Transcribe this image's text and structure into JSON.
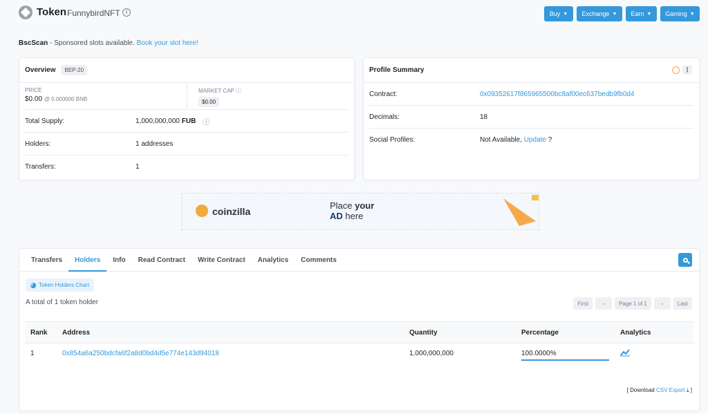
{
  "header": {
    "title": "Token",
    "token_name": "FunnybirdNFT",
    "buttons": [
      "Buy",
      "Exchange",
      "Earn",
      "Gaming"
    ]
  },
  "sponsor": {
    "brand": "BscScan",
    "text": " - Sponsored slots available. ",
    "link": "Book your slot here!"
  },
  "overview": {
    "title": "Overview",
    "badge": "BEP-20",
    "price_label": "PRICE",
    "price_value": "$0.00",
    "price_bnb": "@ 0.000000 BNB",
    "mcap_label": "MARKET CAP",
    "mcap_value": "$0.00",
    "rows": [
      {
        "label": "Total Supply:",
        "value": "1,000,000,000",
        "unit": "FUB"
      },
      {
        "label": "Holders:",
        "value": "1 addresses"
      },
      {
        "label": "Transfers:",
        "value": "1"
      }
    ]
  },
  "profile": {
    "title": "Profile Summary",
    "rows": [
      {
        "label": "Contract:",
        "value": "0x09352617f865965500bc8af00ec637bedb9fb0d4"
      },
      {
        "label": "Decimals:",
        "value": "18"
      },
      {
        "label": "Social Profiles:",
        "value": "Not Available,",
        "link": "Update",
        "suffix": "?"
      }
    ]
  },
  "ad": {
    "brand": "coinzilla",
    "line1a": "Place ",
    "line1b": "your",
    "line2a": "AD",
    "line2b": " here"
  },
  "tabs": [
    "Transfers",
    "Holders",
    "Info",
    "Read Contract",
    "Write Contract",
    "Analytics",
    "Comments"
  ],
  "holders": {
    "chart_button": "Token Holders Chart",
    "total_text": "A total of 1 token holder",
    "pager": {
      "first": "First",
      "prev": "‹",
      "page": "Page 1 of 1",
      "next": "›",
      "last": "Last"
    },
    "columns": [
      "Rank",
      "Address",
      "Quantity",
      "Percentage",
      "Analytics"
    ],
    "rows": [
      {
        "rank": "1",
        "address": "0x854a6a250bdcfa6f2a8d0bd4d5e774e143d94018",
        "quantity": "1,000,000,000",
        "percentage": "100.0000%"
      }
    ],
    "download_prefix": "[ Download",
    "download_link": "CSV Export",
    "download_suffix": "]"
  }
}
